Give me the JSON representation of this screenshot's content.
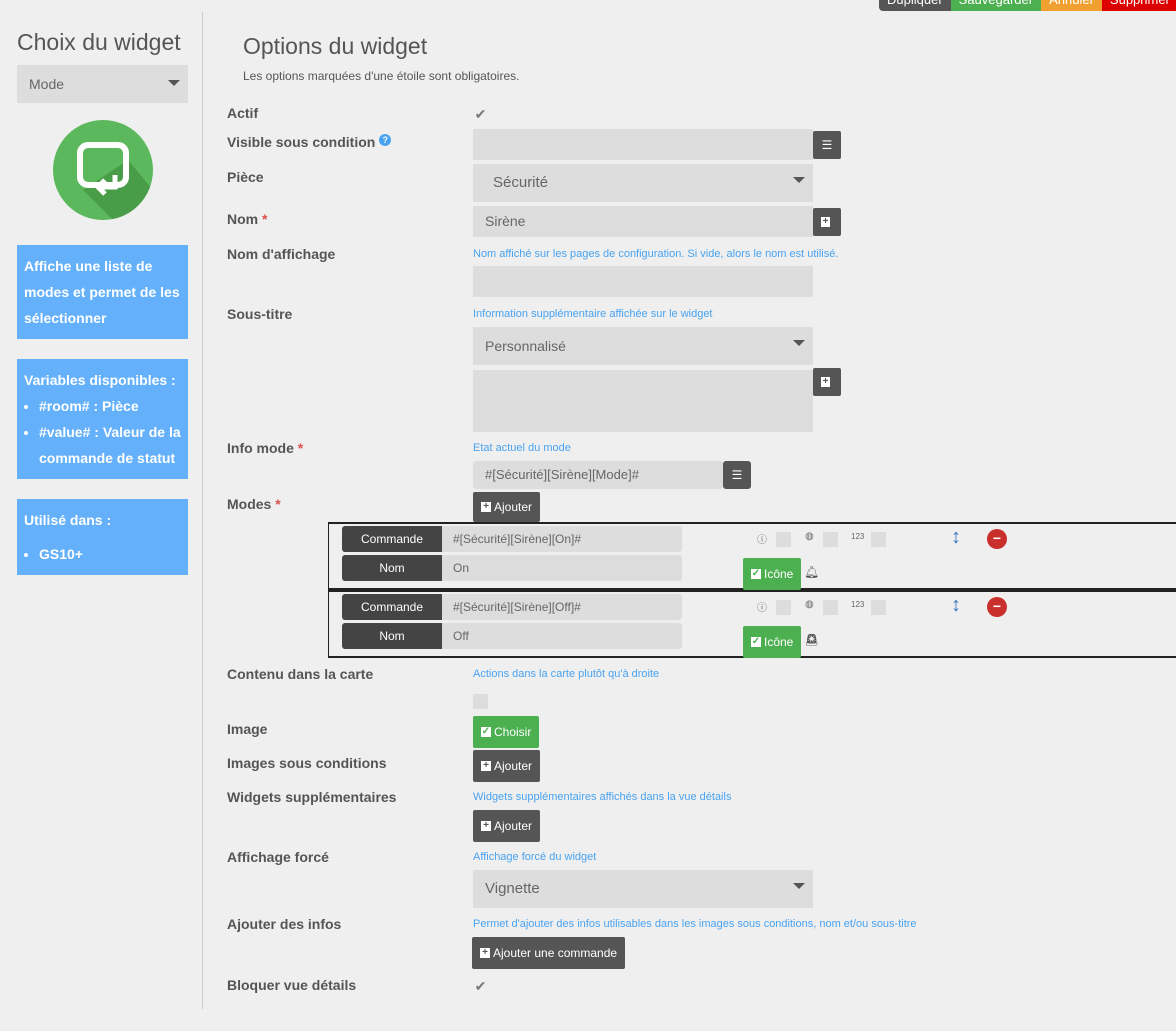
{
  "toolbar": {
    "duplicate": "Dupliquer",
    "save": "Sauvegarder",
    "cancel": "Annuler",
    "delete": "Supprimer"
  },
  "sidebar": {
    "title": "Choix du widget",
    "widget_select": "Mode",
    "description": "Affiche une liste de modes et permet de les sélectionner",
    "variables_title": "Variables disponibles :",
    "variables": [
      "#room# : Pièce",
      "#value# : Valeur de la commande de statut"
    ],
    "used_in_title": "Utilisé dans :",
    "used_in": [
      "GS10+"
    ]
  },
  "main": {
    "title": "Options du widget",
    "subtitle": "Les options marquées d'une étoile sont obligatoires.",
    "actif": "Actif",
    "visible": "Visible sous condition",
    "piece": "Pièce",
    "piece_value": "Sécurité",
    "nom": "Nom",
    "nom_value": "Sirène",
    "nom_affichage": "Nom d'affichage",
    "nom_affichage_hint": "Nom affiché sur les pages de configuration. Si vide, alors le nom est utilisé.",
    "sous_titre": "Sous-titre",
    "sous_titre_hint": "Information supplémentaire affichée sur le widget",
    "sous_titre_value": "Personnalisé",
    "info_mode": "Info mode",
    "info_mode_hint": "Etat actuel du mode",
    "info_mode_value": "#[Sécurité][Sirène][Mode]#",
    "modes": "Modes",
    "ajouter": "Ajouter",
    "mode_rows": [
      {
        "cmd_label": "Commande",
        "cmd": "#[Sécurité][Sirène][On]#",
        "name_label": "Nom",
        "name": "On",
        "icon_btn": "Icône"
      },
      {
        "cmd_label": "Commande",
        "cmd": "#[Sécurité][Sirène][Off]#",
        "name_label": "Nom",
        "name": "Off",
        "icon_btn": "Icône"
      }
    ],
    "num_label": "123",
    "contenu": "Contenu dans la carte",
    "contenu_hint": "Actions dans la carte plutôt qu'à droite",
    "image": "Image",
    "choisir": "Choisir",
    "images_cond": "Images sous conditions",
    "widgets_sup": "Widgets supplémentaires",
    "widgets_sup_hint": "Widgets supplémentaires affichés dans la vue détails",
    "affichage": "Affichage forcé",
    "affichage_hint": "Affichage forcé du widget",
    "affichage_value": "Vignette",
    "ajouter_infos": "Ajouter des infos",
    "ajouter_infos_hint": "Permet d'ajouter des infos utilisables dans les images sous conditions, nom et/ou sous-titre",
    "ajouter_commande": "Ajouter une commande",
    "bloquer": "Bloquer vue détails"
  },
  "colors": {
    "accent": "#64b0fa",
    "green": "#4caf50",
    "dark": "#555555",
    "orange": "#f0a030",
    "red": "#d00000"
  }
}
